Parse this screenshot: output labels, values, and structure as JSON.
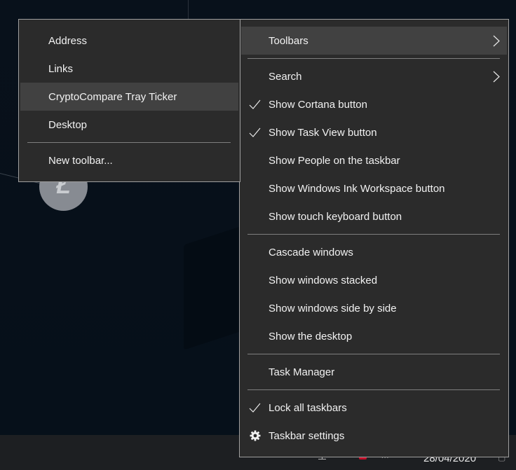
{
  "toolbars_submenu": {
    "items": [
      {
        "label": "Address",
        "highlighted": false
      },
      {
        "label": "Links",
        "highlighted": false
      },
      {
        "label": "CryptoCompare Tray Ticker",
        "highlighted": true
      },
      {
        "label": "Desktop",
        "highlighted": false
      },
      {
        "label": "New toolbar...",
        "highlighted": false
      }
    ]
  },
  "context_menu": {
    "toolbars": {
      "label": "Toolbars",
      "has_submenu": true,
      "highlighted": true
    },
    "search": {
      "label": "Search",
      "has_submenu": true
    },
    "show_cortana": {
      "label": "Show Cortana button",
      "checked": true
    },
    "show_task_view": {
      "label": "Show Task View button",
      "checked": true
    },
    "show_people": {
      "label": "Show People on the taskbar",
      "checked": false
    },
    "show_ink": {
      "label": "Show Windows Ink Workspace button",
      "checked": false
    },
    "show_touch_keyboard": {
      "label": "Show touch keyboard button",
      "checked": false
    },
    "cascade": {
      "label": "Cascade windows"
    },
    "stacked": {
      "label": "Show windows stacked"
    },
    "side_by_side": {
      "label": "Show windows side by side"
    },
    "show_desktop": {
      "label": "Show the desktop"
    },
    "task_manager": {
      "label": "Task Manager"
    },
    "lock_taskbars": {
      "label": "Lock all taskbars",
      "checked": true
    },
    "taskbar_settings": {
      "label": "Taskbar settings",
      "icon": "gear-icon"
    }
  },
  "desktop": {
    "coin_icon": "litecoin-icon",
    "coin_glyph": "Ł"
  },
  "taskbar": {
    "date": "28/04/2020",
    "overflow_glyph": "...",
    "notification_glyph": "▢"
  },
  "colors": {
    "menu_background": "#2b2b2b",
    "menu_highlight": "#414141",
    "menu_border": "#9f9f9f",
    "separator": "#7e7e7e",
    "desktop_background": "#07101a",
    "taskbar_background": "#1d1f22"
  }
}
